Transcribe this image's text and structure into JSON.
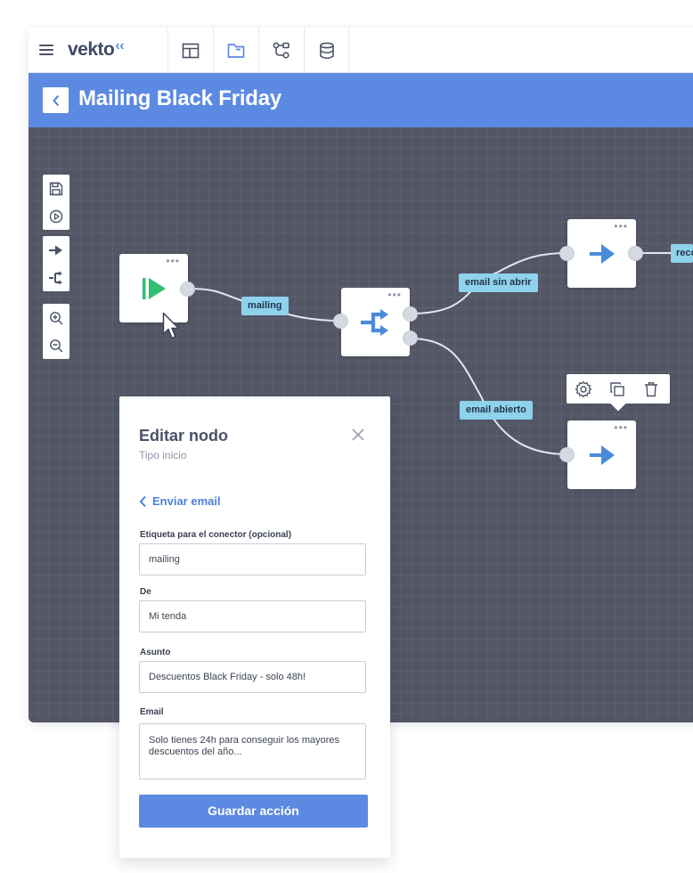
{
  "app": {
    "logo_text": "vekto",
    "logo_mark": "‹‹",
    "tabs": [
      {
        "icon": "layout-icon"
      },
      {
        "icon": "folder-icon"
      },
      {
        "icon": "workflow-icon"
      },
      {
        "icon": "database-icon"
      }
    ]
  },
  "title_bar": {
    "title": "Mailing Black Friday",
    "back_icon": "chevron-left-icon"
  },
  "canvas_tools": {
    "group1": [
      "save-icon",
      "play-icon"
    ],
    "group2": [
      "arrow-right-icon",
      "split-icon"
    ],
    "group3": [
      "zoom-in-icon",
      "zoom-out-icon"
    ]
  },
  "nodes": {
    "start": {
      "icon": "start-play-icon",
      "menu": "•••"
    },
    "split": {
      "icon": "split-icon",
      "menu": "•••"
    },
    "action_top": {
      "icon": "arrow-right-icon",
      "menu": "•••"
    },
    "action_bottom": {
      "icon": "arrow-right-icon",
      "menu": "•••"
    }
  },
  "connector_labels": {
    "mailing": "mailing",
    "not_opened": "email sin abrir",
    "opened": "email abierto",
    "right_cut": "reco"
  },
  "node_toolbar": {
    "items": [
      "gear-icon",
      "copy-icon",
      "trash-icon"
    ]
  },
  "panel": {
    "title": "Editar nodo",
    "subtitle": "Tipo inicio",
    "back_link": "Enviar email",
    "fields": {
      "connector_label": {
        "label": "Etiqueta para el conector (opcional)",
        "value": "mailing"
      },
      "from": {
        "label": "De",
        "value": "Mi tenda"
      },
      "subject": {
        "label": "Asunto",
        "value": "Descuentos Black Friday - solo 48h!"
      },
      "email": {
        "label": "Email",
        "value": "Solo tienes 24h para conseguir los mayores descuentos del año..."
      }
    },
    "save_label": "Guardar acción"
  },
  "colors": {
    "accent": "#5c89e2",
    "canvas": "#525665",
    "label_bg": "#8ed2ec",
    "start_green": "#2fbf71",
    "node_blue": "#4a8ad8"
  }
}
